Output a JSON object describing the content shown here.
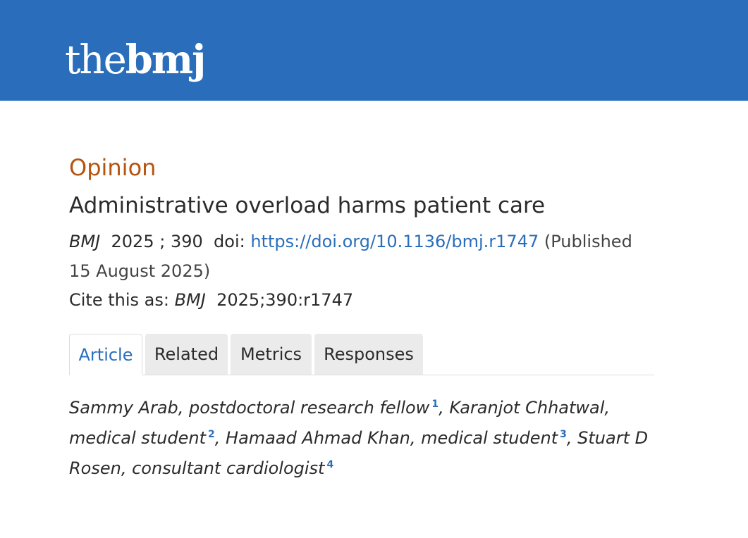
{
  "header": {
    "logo_light": "the",
    "logo_bold": "bmj",
    "background_color": "#2a6ebb"
  },
  "article": {
    "section": "Opinion",
    "title": "Administrative overload harms patient care",
    "citation": {
      "journal": "BMJ",
      "year": "2025",
      "separator": ";",
      "volume": "390",
      "doi_label": "doi:",
      "doi_url": "https://doi.org/10.1136/bmj.r1747",
      "published": "(Published 15 August 2025)"
    },
    "cite_as": {
      "label": "Cite this as:",
      "journal": "BMJ",
      "reference": "2025;390:r1747"
    }
  },
  "tabs": [
    {
      "label": "Article",
      "active": true
    },
    {
      "label": "Related",
      "active": false
    },
    {
      "label": "Metrics",
      "active": false
    },
    {
      "label": "Responses",
      "active": false
    }
  ],
  "authors": [
    {
      "name": "Sammy Arab, postdoctoral research fellow",
      "affiliation": "1",
      "separator": ", "
    },
    {
      "name": "Karanjot Chhatwal, medical student",
      "affiliation": "2",
      "separator": ", "
    },
    {
      "name": "Hamaad Ahmad Khan, medical student",
      "affiliation": "3",
      "separator": ", "
    },
    {
      "name": "Stuart D Rosen, consultant cardiologist",
      "affiliation": "4",
      "separator": ""
    }
  ],
  "colors": {
    "section": "#b5540f",
    "link": "#2a6ebb",
    "text": "#2b2b2b"
  }
}
